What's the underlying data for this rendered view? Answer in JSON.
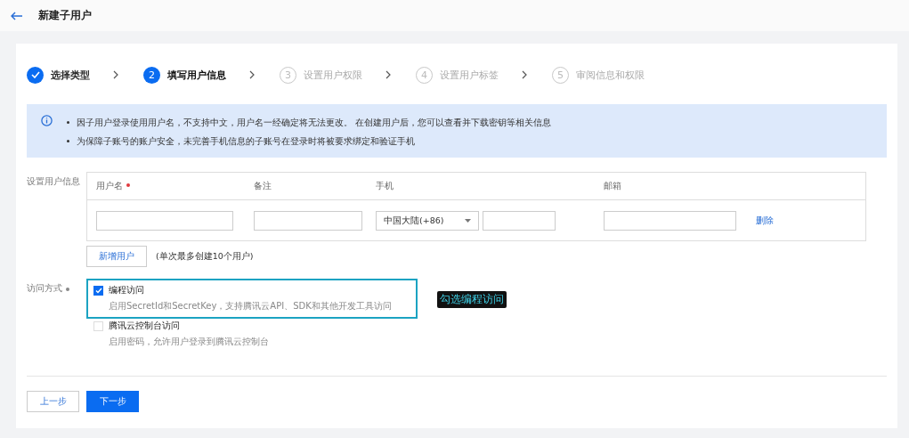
{
  "header": {
    "title": "新建子用户"
  },
  "steps": [
    {
      "label": "选择类型",
      "done": true,
      "selected": false
    },
    {
      "number": "2",
      "label": "填写用户信息",
      "done": false,
      "selected": true
    },
    {
      "number": "3",
      "label": "设置用户权限",
      "done": false,
      "selected": false
    },
    {
      "number": "4",
      "label": "设置用户标签",
      "done": false,
      "selected": false
    },
    {
      "number": "5",
      "label": "审阅信息和权限",
      "done": false,
      "selected": false
    }
  ],
  "notice": [
    "因子用户登录使用用户名，不支持中文，用户名一经确定将无法更改。 在创建用户后，您可以查看并下载密钥等相关信息",
    "为保障子账号的账户安全，未完善手机信息的子账号在登录时将被要求绑定和验证手机"
  ],
  "user_info": {
    "label": "设置用户信息",
    "columns": [
      {
        "label": "用户名",
        "required": true
      },
      {
        "label": "备注",
        "required": false
      },
      {
        "label": "手机",
        "required": false
      },
      {
        "label": "邮箱",
        "required": false
      }
    ],
    "row": {
      "region": "中国大陆(+86)",
      "delete": "删除"
    },
    "add_button": "新增用户",
    "add_hint": "(单次最多创建10个用户)"
  },
  "access": {
    "label": "访问方式",
    "required": true,
    "options": [
      {
        "title": "编程访问",
        "desc": "启用SecretId和SecretKey，支持腾讯云API、SDK和其他开发工具访问",
        "checked": true,
        "highlighted": true
      },
      {
        "title": "腾讯云控制台访问",
        "desc": "启用密码，允许用户登录到腾讯云控制台",
        "checked": false,
        "highlighted": false
      }
    ],
    "callout": "勾选编程访问"
  },
  "buttons": {
    "prev": "上一步",
    "next": "下一步"
  }
}
